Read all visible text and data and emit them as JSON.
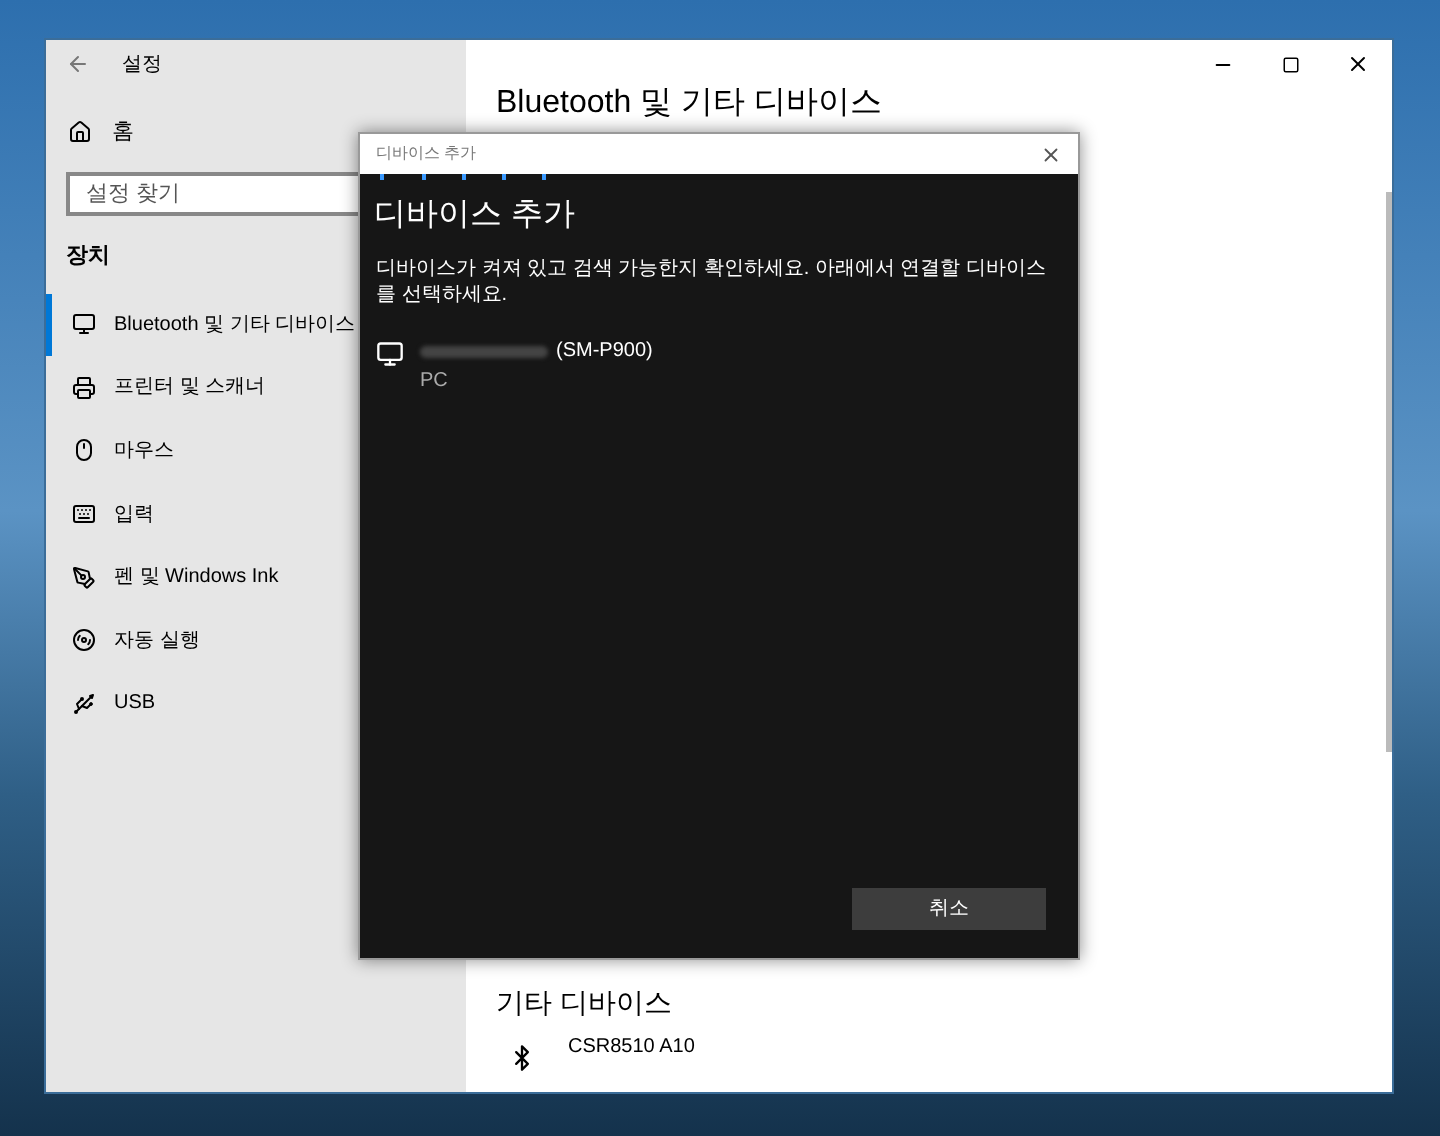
{
  "window": {
    "title": "설정"
  },
  "sidebar": {
    "home": "홈",
    "search": {
      "placeholder": "설정 찾기"
    },
    "section": "장치",
    "items": [
      {
        "kind": "bluetooth",
        "label": "Bluetooth 및 기타 디바이스",
        "selected": true
      },
      {
        "kind": "printer",
        "label": "프린터 및 스캐너",
        "selected": false
      },
      {
        "kind": "mouse",
        "label": "마우스",
        "selected": false
      },
      {
        "kind": "keyboard",
        "label": "입력",
        "selected": false
      },
      {
        "kind": "pen",
        "label": "펜 및 Windows Ink",
        "selected": false
      },
      {
        "kind": "autoplay",
        "label": "자동 실행",
        "selected": false
      },
      {
        "kind": "usb",
        "label": "USB",
        "selected": false
      }
    ]
  },
  "main": {
    "title": "Bluetooth 및 기타 디바이스",
    "other_heading": "기타 디바이스",
    "other_devices": [
      {
        "name": "CSR8510 A10"
      }
    ]
  },
  "dialog": {
    "title": "디바이스 추가",
    "heading": "디바이스 추가",
    "description": "디바이스가 켜져 있고 검색 가능한지 확인하세요. 아래에서 연결할 디바이스를 선택하세요.",
    "devices": [
      {
        "name": "(SM-P900)",
        "type": "PC"
      }
    ],
    "cancel": "취소"
  }
}
